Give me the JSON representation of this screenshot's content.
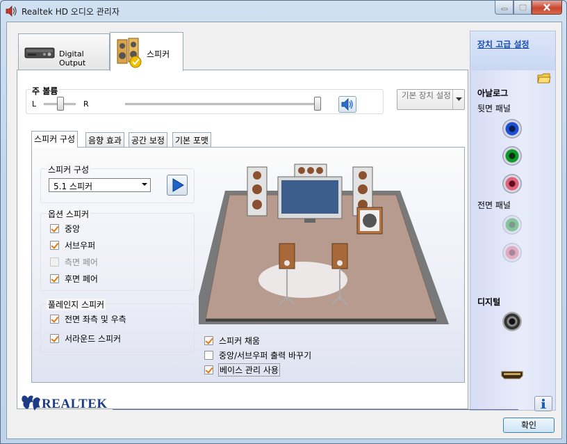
{
  "window": {
    "title": "Realtek HD 오디오 관리자"
  },
  "tabs": [
    {
      "label": "Digital Output"
    },
    {
      "label": "스피커"
    }
  ],
  "volume": {
    "legend": "주 볼륨",
    "left_label": "L",
    "right_label": "R",
    "balance": 0.5,
    "level": 1.0,
    "default_device_label": "기본 장치 설정"
  },
  "subtabs": [
    "스피커 구성",
    "음향 효과",
    "공간 보정",
    "기본 포맷"
  ],
  "speaker_config": {
    "legend": "스피커 구성",
    "selected": "5.1 스피커"
  },
  "optional_speakers": {
    "legend": "옵션 스피커",
    "items": [
      {
        "label": "중앙",
        "checked": true,
        "disabled": false
      },
      {
        "label": "서브우퍼",
        "checked": true,
        "disabled": false
      },
      {
        "label": "측면 페어",
        "checked": false,
        "disabled": true
      },
      {
        "label": "후면 페어",
        "checked": true,
        "disabled": false
      }
    ]
  },
  "fullrange_speakers": {
    "legend": "풀레인지 스피커",
    "items": [
      {
        "label": "전면 좌측 및 우측",
        "checked": true
      },
      {
        "label": "서라운드 스피커",
        "checked": true
      }
    ]
  },
  "bottom_options": [
    {
      "label": "스피커 채움",
      "checked": true
    },
    {
      "label": "중앙/서브우퍼 출력 바꾸기",
      "checked": false
    },
    {
      "label": "베이스 관리 사용",
      "checked": true
    }
  ],
  "right_panel": {
    "advanced_link": "장치 고급 설정",
    "analog": "아날로그",
    "back_panel": "뒷면 패널",
    "front_panel": "전면 패널",
    "digital": "디지털",
    "jack_colors": {
      "blue": "#1a4fd6",
      "green": "#0e9a2a",
      "pink": "#e0607a"
    }
  },
  "footer": {
    "brand": "REALTEK",
    "ok": "확인"
  }
}
